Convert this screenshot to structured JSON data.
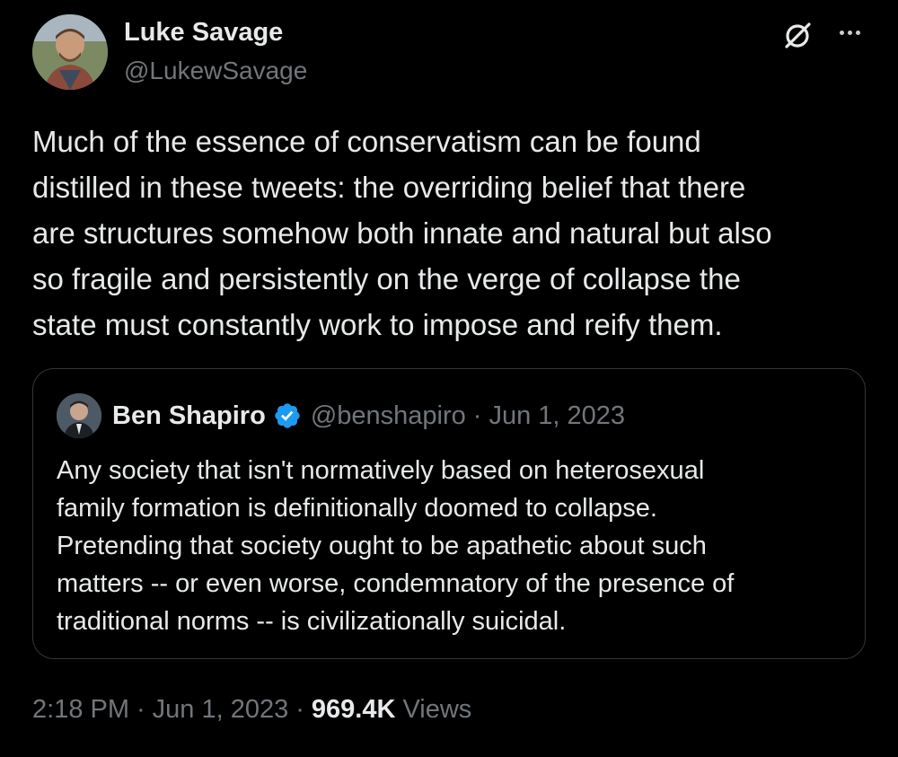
{
  "tweet": {
    "author_name": "Luke Savage",
    "author_handle": "@LukewSavage",
    "text": "Much of the essence of conservatism can be found\ndistilled in these tweets: the overriding belief that there\nare structures somehow both innate and natural but also\nso fragile and persistently on the verge of collapse the\nstate must constantly work to impose and reify them.",
    "time": "2:18 PM",
    "date": "Jun 1, 2023",
    "separator": "·",
    "views_count": "969.4K",
    "views_label": "Views"
  },
  "quote": {
    "author_name": "Ben Shapiro",
    "author_handle": "@benshapiro",
    "separator": "·",
    "date": "Jun 1, 2023",
    "text": "Any society that isn't normatively based on heterosexual\nfamily formation is definitionally doomed to collapse.\nPretending that society ought to be apathetic about such\nmatters -- or even worse, condemnatory of the presence of\ntraditional norms -- is civilizationally suicidal."
  },
  "icons": {
    "grok": "grok-icon",
    "more": "more-icon",
    "verified": "verified-badge-icon"
  },
  "colors": {
    "background": "#000000",
    "text_primary": "#e7e9ea",
    "text_secondary": "#71767b",
    "border": "#333639",
    "verified": "#1d9bf0"
  }
}
